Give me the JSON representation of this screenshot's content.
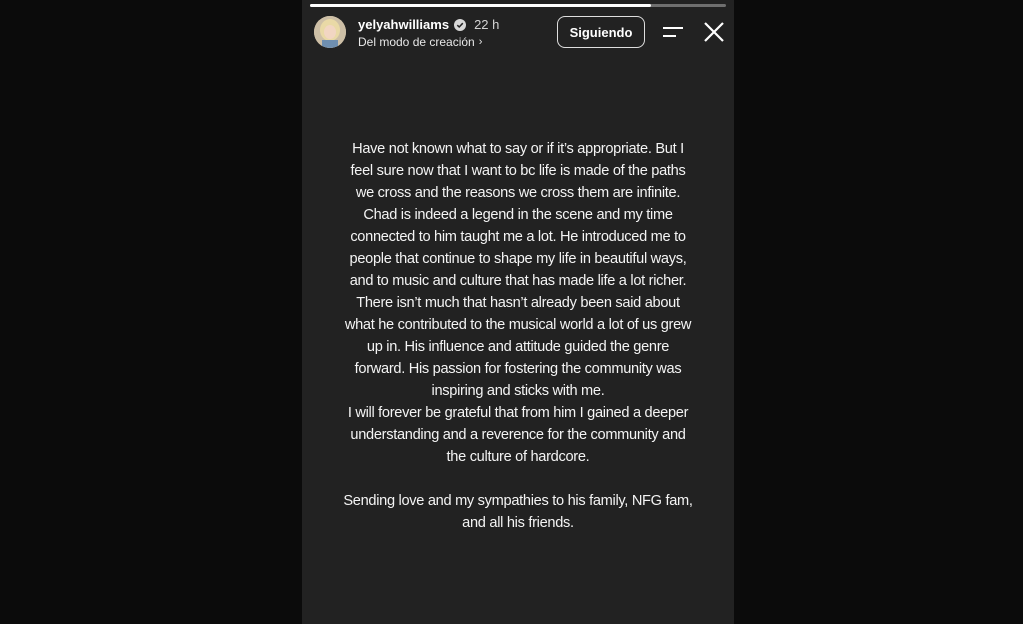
{
  "story": {
    "progress_fraction": 0.82,
    "username": "yelyahwilliams",
    "verified_icon": "verified-badge-icon",
    "time_ago": "22 h",
    "source_label": "Del modo de creación",
    "source_chevron": "›",
    "follow_button_label": "Siguiendo",
    "menu_icon": "menu-lines-icon",
    "close_icon": "close-icon"
  },
  "post": {
    "paragraphs": [
      "Have not known what to say or if it’s appropriate. But I feel sure now that I want to bc life is made of the paths we cross and the reasons we cross them are infinite.",
      "Chad is indeed a legend in the scene and my time connected to him taught me a lot. He introduced me to people that continue to shape my life in beautiful ways, and to music and culture that has made life a lot richer.",
      "There isn’t much that hasn’t already been said about what he contributed to the musical world a lot of us grew up in. His influence and attitude guided the genre forward. His  passion for fostering the community was inspiring and sticks with me.",
      "I will forever be grateful that from him I gained a deeper understanding and a reverence for the community and the culture of hardcore."
    ],
    "closing": "Sending love and my sympathies to his family, NFG fam, and all his friends."
  },
  "colors": {
    "page_background": "#0b0b0b",
    "story_background": "#222222",
    "text": "#f4f4f4",
    "verified_blue": "#3897f0"
  }
}
